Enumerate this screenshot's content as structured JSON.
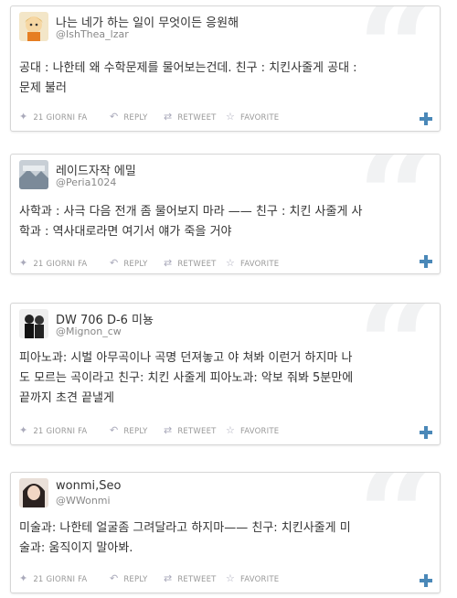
{
  "tweets": [
    {
      "name": "나는 네가 하는 일이 무엇이든 응원해",
      "handle": "@IshThea_lzar",
      "text_lines": [
        "공대 : 나한테 왜 수학문제를 물어보는건데. 친구 : 치킨사줄게 공대 :",
        "문제 불러"
      ],
      "time": "21 GIORNI FA",
      "reply": "REPLY",
      "retweet": "RETWEET",
      "favorite": "FAVORITE"
    },
    {
      "name": "레이드자작 에밀",
      "handle": "@Peria1024",
      "text_lines": [
        "사학과 : 사극 다음 전개 좀 물어보지 마라 —— 친구 : 치킨 사줄게 사",
        "학과 : 역사대로라면 여기서 얘가 죽을 거야"
      ],
      "time": "21 GIORNI FA",
      "reply": "REPLY",
      "retweet": "RETWEET",
      "favorite": "FAVORITE"
    },
    {
      "name": "DW 706 D-6 미뇽",
      "handle": "@Mignon_cw",
      "text_lines": [
        "피아노과: 시벌 아무곡이나 곡명 던져놓고 야 쳐봐 이런거 하지마 나",
        "도 모르는 곡이라고 친구: 치킨 사줄게 피아노과: 악보 줘봐 5분만에",
        "끝까지 초견 끝낼게"
      ],
      "time": "21 GIORNI FA",
      "reply": "REPLY",
      "retweet": "RETWEET",
      "favorite": "FAVORITE"
    },
    {
      "name": "wonmi,Seo",
      "handle": "@WWonmi",
      "text_lines": [
        "미술과: 나한테 얼굴좀 그려달라고 하지마—— 친구: 치킨사줄게 미",
        "술과: 움직이지 말아봐."
      ],
      "time": "21 GIORNI FA",
      "reply": "REPLY",
      "retweet": "RETWEET",
      "favorite": "FAVORITE"
    }
  ],
  "icons": {
    "bird": "twitter-bird-icon",
    "reply": "reply-arrow-icon",
    "retweet": "retweet-icon",
    "favorite": "star-icon",
    "expand": "plus-icon",
    "quote": "quote-mark-icon"
  },
  "colors": {
    "accent": "#4a88b8",
    "meta": "#999999",
    "quote": "#f1f2f3"
  }
}
